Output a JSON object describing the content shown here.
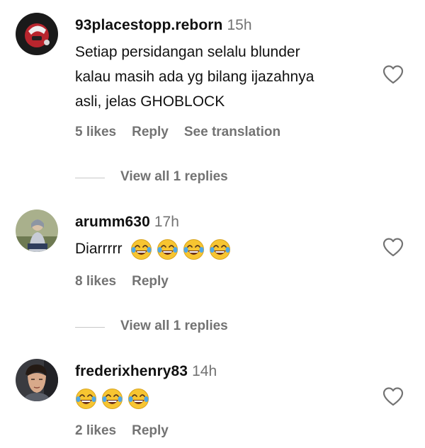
{
  "comments": [
    {
      "username": "93placestopp.reborn",
      "time": "15h",
      "text_lines": [
        "Setiap persidangan selalu blunder",
        "kalau masih ada yg bilang ijazahnya",
        "asli, jelas GHOBLOCK"
      ],
      "likes": "5 likes",
      "reply": "Reply",
      "translate": "See translation",
      "view_replies": "View all 1 replies",
      "emoji_count": 0
    },
    {
      "username": "arumm630",
      "time": "17h",
      "text_lines": [
        "Diarrrrr"
      ],
      "likes": "8 likes",
      "reply": "Reply",
      "view_replies": "View all 1 replies",
      "emoji": "face-with-tears-of-joy-emoji",
      "emoji_count": 4
    },
    {
      "username": "frederixhenry83",
      "time": "14h",
      "text_lines": [],
      "likes": "2 likes",
      "reply": "Reply",
      "emoji": "face-with-tears-of-joy-emoji",
      "emoji_count": 3
    }
  ],
  "icons": {
    "like": "heart-outline-icon"
  },
  "colors": {
    "primary_text": "#111111",
    "secondary_text": "#737373",
    "divider": "#c7c7c7",
    "emoji_face": "#f7c531",
    "emoji_tears": "#4fa7e6"
  }
}
